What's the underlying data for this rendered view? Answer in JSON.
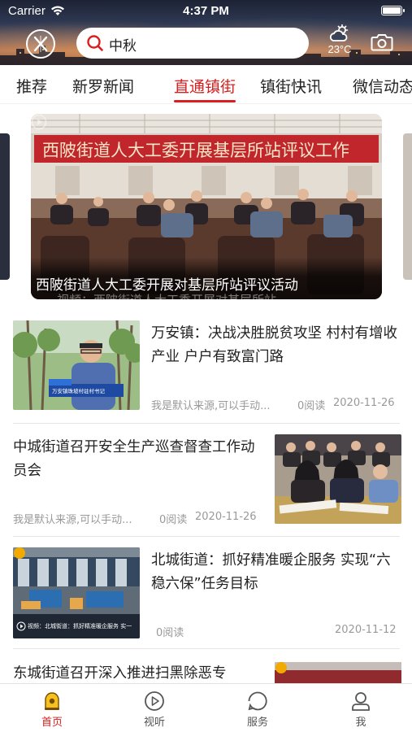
{
  "status_bar": {
    "carrier": "Carrier",
    "time": "4:37 PM"
  },
  "header": {
    "search": {
      "value": "中秋",
      "icon": "search-icon"
    },
    "weather": {
      "temperature": "23°C",
      "icon": "sun-cloud-icon"
    },
    "camera_icon": "camera-icon"
  },
  "tabs": [
    {
      "label": "推荐",
      "active": false
    },
    {
      "label": "新罗新闻",
      "active": false
    },
    {
      "label": "直通镇街",
      "active": true
    },
    {
      "label": "镇街快讯",
      "active": false
    },
    {
      "label": "微信动态",
      "active": false
    }
  ],
  "banner": {
    "image_text": "西陂街道人大工委开展基层所站评议工作",
    "title": "西陂街道人大工委开展对基层所站评议活动",
    "subtitle": "视频：西陂街道人大工委开展对基层所站…"
  },
  "news": [
    {
      "title": "万安镇：决战决胜脱贫攻坚 村村有增收产业 户户有致富门路",
      "source": "我是默认来源,可以手动...",
      "reads": "0阅读",
      "date": "2020-11-26",
      "thumb_caption": "万安镇珠坡村驻村书记"
    },
    {
      "title": "中城街道召开安全生产巡查督查工作动员会",
      "source": "我是默认来源,可以手动...",
      "reads": "0阅读",
      "date": "2020-11-26"
    },
    {
      "title": "北城街道：抓好精准暖企服务 实现“六稳六保”任务目标",
      "source": "",
      "reads": "0阅读",
      "date": "2020-11-12",
      "thumb_caption": "视频：北城街道：抓好精准暖企服务  实一"
    },
    {
      "title": "东城街道召开深入推进扫黑除恶专",
      "source": "",
      "reads": "",
      "date": ""
    }
  ],
  "bottom_nav": [
    {
      "label": "首页",
      "icon": "home-icon",
      "active": true
    },
    {
      "label": "视听",
      "icon": "play-icon",
      "active": false
    },
    {
      "label": "服务",
      "icon": "service-icon",
      "active": false
    },
    {
      "label": "我",
      "icon": "profile-icon",
      "active": false
    }
  ],
  "colors": {
    "accent": "#d81e1e",
    "meta_text": "#999999"
  }
}
